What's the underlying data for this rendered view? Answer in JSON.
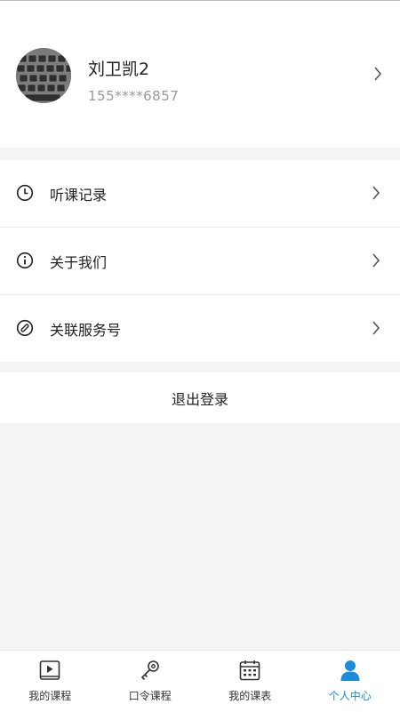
{
  "profile": {
    "name": "刘卫凯2",
    "phone": "155****6857"
  },
  "menu": {
    "items": [
      {
        "label": "听课记录",
        "icon": "clock-icon"
      },
      {
        "label": "关于我们",
        "icon": "info-icon"
      },
      {
        "label": "关联服务号",
        "icon": "link-icon"
      }
    ]
  },
  "logout": {
    "label": "退出登录"
  },
  "tabbar": {
    "active_color": "#1a8cd8",
    "tabs": [
      {
        "label": "我的课程",
        "icon": "play-icon",
        "active": false
      },
      {
        "label": "口令课程",
        "icon": "key-icon",
        "active": false
      },
      {
        "label": "我的课表",
        "icon": "calendar-icon",
        "active": false
      },
      {
        "label": "个人中心",
        "icon": "person-icon",
        "active": true
      }
    ]
  }
}
